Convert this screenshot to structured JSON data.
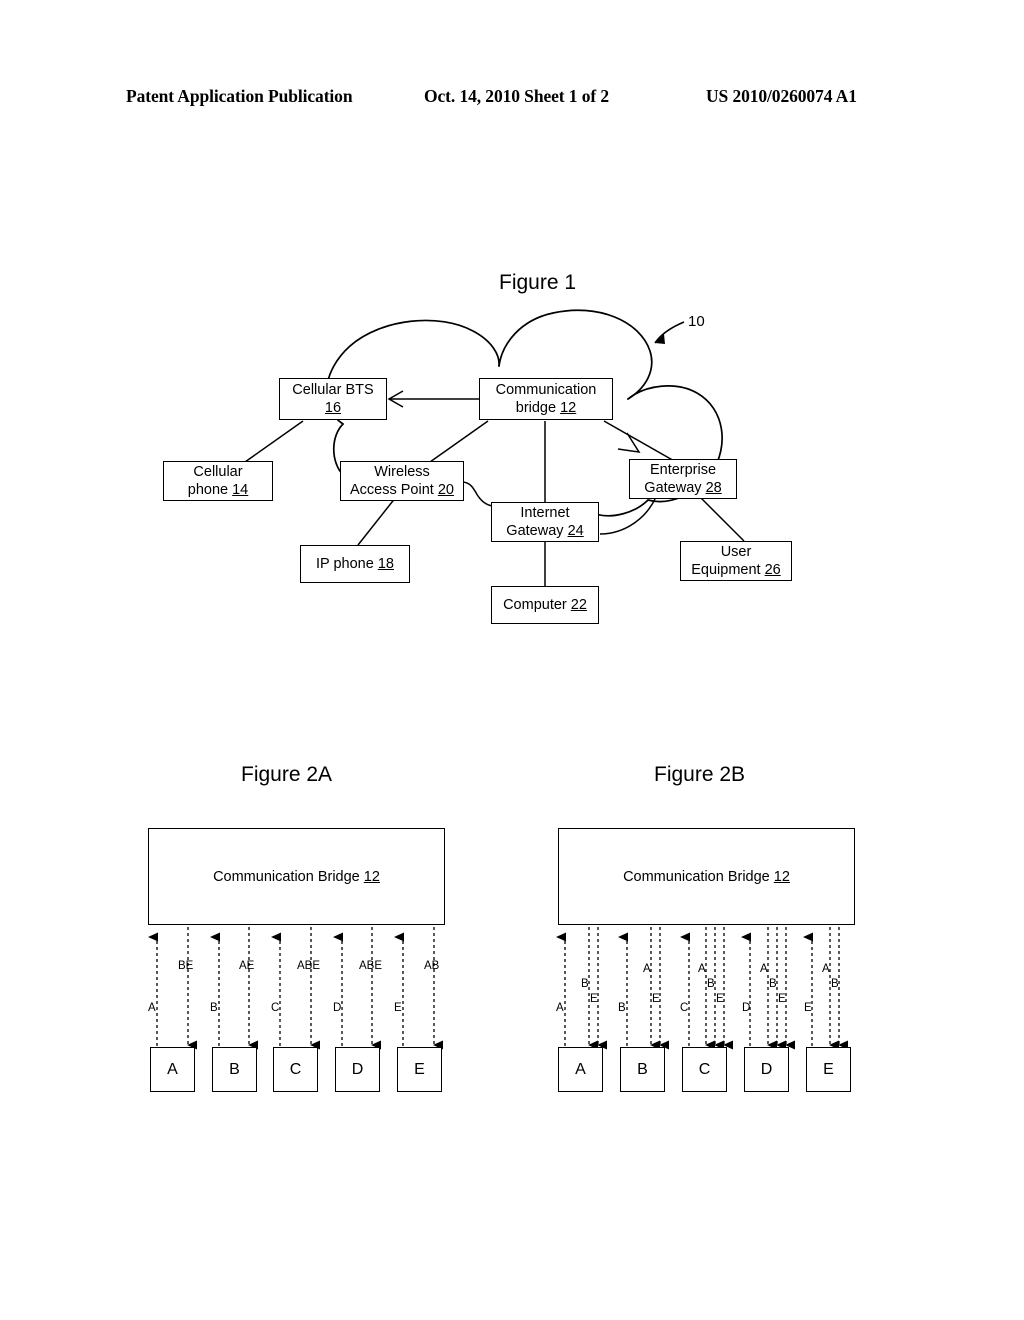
{
  "header": {
    "left": "Patent Application Publication",
    "middle": "Oct. 14, 2010  Sheet 1 of 2",
    "right": "US 2010/0260074 A1"
  },
  "figures": {
    "fig1": {
      "title": "Figure 1",
      "cloud_ref": "10",
      "nodes": [
        {
          "id": "cellular-bts",
          "line1": "Cellular BTS",
          "line2": "16",
          "ref": "16"
        },
        {
          "id": "communication-bridge",
          "line1": "Communication",
          "line2": "bridge",
          "ref": "12"
        },
        {
          "id": "cellular-phone",
          "line1": "Cellular",
          "line2": "phone",
          "ref": "14"
        },
        {
          "id": "wireless-access-point",
          "line1": "Wireless",
          "line2": "Access Point",
          "ref": "20"
        },
        {
          "id": "enterprise-gateway",
          "line1": "Enterprise",
          "line2": "Gateway",
          "ref": "28"
        },
        {
          "id": "internet-gateway",
          "line1": "Internet",
          "line2": "Gateway",
          "ref": "24"
        },
        {
          "id": "ip-phone",
          "line1": "IP phone",
          "line2": "",
          "ref": "18"
        },
        {
          "id": "user-equipment",
          "line1": "User",
          "line2": "Equipment",
          "ref": "26"
        },
        {
          "id": "computer",
          "line1": "Computer",
          "line2": "",
          "ref": "22"
        }
      ]
    },
    "fig2a": {
      "title": "Figure 2A",
      "bridge_label": "Communication Bridge",
      "bridge_ref": "12",
      "nodes": [
        "A",
        "B",
        "C",
        "D",
        "E"
      ],
      "uplink_labels": [
        "A",
        "B",
        "C",
        "D",
        "E"
      ],
      "downlink_labels": [
        "BE",
        "AE",
        "ABE",
        "ABE",
        "AB"
      ]
    },
    "fig2b": {
      "title": "Figure 2B",
      "bridge_label": "Communication Bridge",
      "bridge_ref": "12",
      "nodes": [
        "A",
        "B",
        "C",
        "D",
        "E"
      ],
      "uplink_labels": [
        "A",
        "B",
        "C",
        "D",
        "E"
      ],
      "downlink_groups": [
        [
          "B",
          "E"
        ],
        [
          "A",
          "E"
        ],
        [
          "A",
          "B",
          "E"
        ],
        [
          "A",
          "B",
          "E"
        ],
        [
          "A",
          "B"
        ]
      ]
    }
  },
  "chart_data": {
    "type": "diagram",
    "title": "Communication bridge network topology and media flow",
    "fig1_connections": [
      {
        "from": "communication-bridge",
        "to": "cellular-bts",
        "arrow": "open-v"
      },
      {
        "from": "communication-bridge",
        "to": "wireless-access-point",
        "arrow": "none"
      },
      {
        "from": "communication-bridge",
        "to": "internet-gateway",
        "arrow": "none"
      },
      {
        "from": "communication-bridge",
        "to": "enterprise-gateway",
        "arrow": "open-v"
      },
      {
        "from": "cellular-bts",
        "to": "cellular-phone",
        "arrow": "none"
      },
      {
        "from": "wireless-access-point",
        "to": "ip-phone",
        "arrow": "none"
      },
      {
        "from": "wireless-access-point",
        "to": "internet-gateway",
        "arrow": "none"
      },
      {
        "from": "internet-gateway",
        "to": "computer",
        "arrow": "none"
      },
      {
        "from": "internet-gateway",
        "to": "enterprise-gateway",
        "arrow": "none"
      },
      {
        "from": "enterprise-gateway",
        "to": "user-equipment",
        "arrow": "none"
      }
    ],
    "fig2a_flows": [
      {
        "node": "A",
        "up": "A",
        "down": "BE"
      },
      {
        "node": "B",
        "up": "B",
        "down": "AE"
      },
      {
        "node": "C",
        "up": "C",
        "down": "ABE"
      },
      {
        "node": "D",
        "up": "D",
        "down": "ABE"
      },
      {
        "node": "E",
        "up": "E",
        "down": "AB"
      }
    ],
    "fig2b_flows": [
      {
        "node": "A",
        "up": "A",
        "down": [
          "B",
          "E"
        ]
      },
      {
        "node": "B",
        "up": "B",
        "down": [
          "A",
          "E"
        ]
      },
      {
        "node": "C",
        "up": "C",
        "down": [
          "A",
          "B",
          "E"
        ]
      },
      {
        "node": "D",
        "up": "D",
        "down": [
          "A",
          "B",
          "E"
        ]
      },
      {
        "node": "E",
        "up": "E",
        "down": [
          "A",
          "B"
        ]
      }
    ]
  }
}
